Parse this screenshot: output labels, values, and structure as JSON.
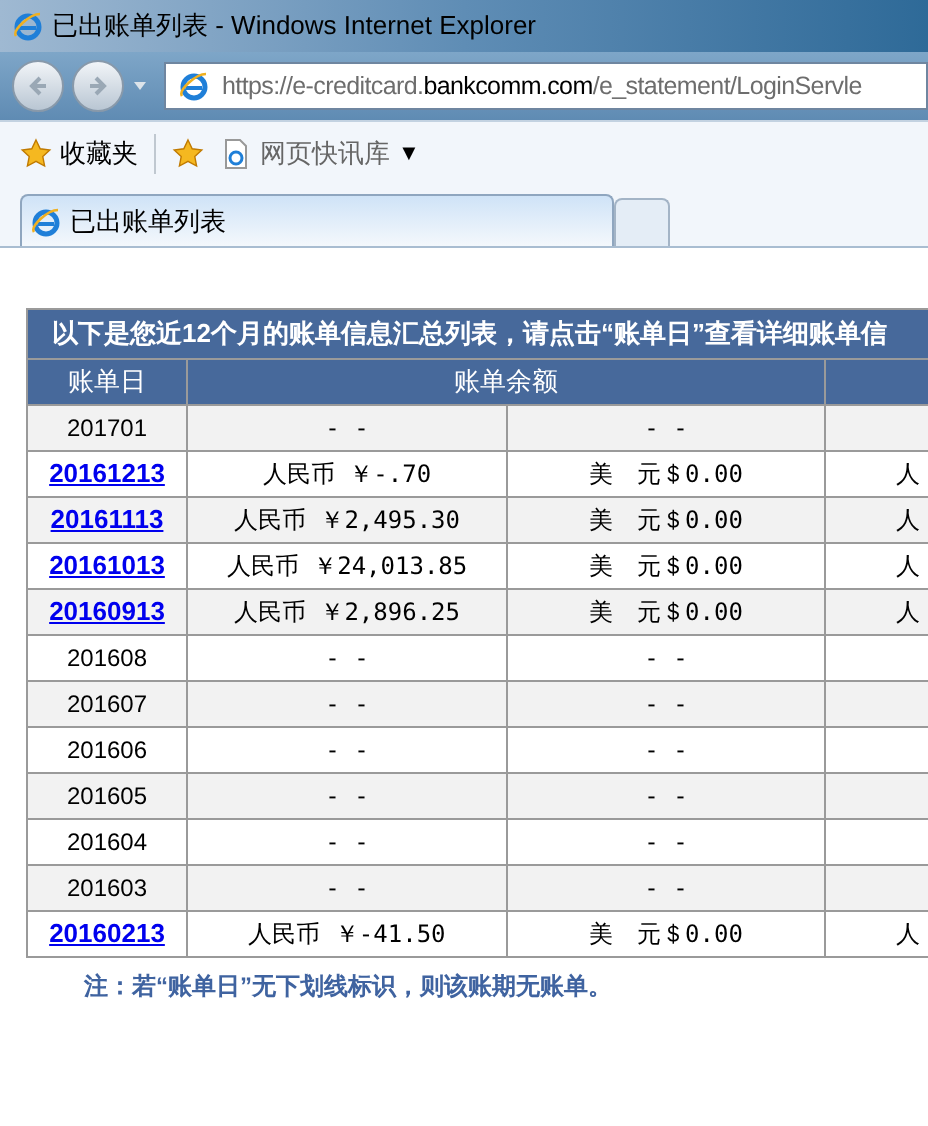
{
  "window": {
    "title": "已出账单列表 - Windows Internet Explorer"
  },
  "address_bar": {
    "url_prefix": "https://e-creditcard.",
    "url_domain": "bankcomm.com",
    "url_path": "/e_statement/LoginServle"
  },
  "favorites_bar": {
    "favorites_label": "收藏夹",
    "feed_label": "网页快讯库",
    "feed_menu_glyph": "▼"
  },
  "tabs": [
    {
      "label": "已出账单列表",
      "selected": true
    },
    {
      "selected": false
    }
  ],
  "table": {
    "caption": "以下是您近12个月的账单信息汇总列表，请点击“账单日”查看详细账单信",
    "columns": [
      "账单日",
      "账单余额"
    ],
    "rows": [
      {
        "date": "201701",
        "linked": false,
        "cny": "- -",
        "usd": "- -"
      },
      {
        "date": "20161213",
        "linked": true,
        "cny": "人民币 ￥-.70",
        "usd": "美　元＄0.00",
        "column_4": "人"
      },
      {
        "date": "20161113",
        "linked": true,
        "cny": "人民币 ￥2,495.30",
        "usd": "美　元＄0.00",
        "column_4": "人"
      },
      {
        "date": "20161013",
        "linked": true,
        "cny": "人民币 ￥24,013.85",
        "usd": "美　元＄0.00",
        "column_4": "人"
      },
      {
        "date": "20160913",
        "linked": true,
        "cny": "人民币 ￥2,896.25",
        "usd": "美　元＄0.00",
        "column_4": "人"
      },
      {
        "date": "201608",
        "linked": false,
        "cny": "- -",
        "usd": "- -"
      },
      {
        "date": "201607",
        "linked": false,
        "cny": "- -",
        "usd": "- -"
      },
      {
        "date": "201606",
        "linked": false,
        "cny": "- -",
        "usd": "- -"
      },
      {
        "date": "201605",
        "linked": false,
        "cny": "- -",
        "usd": "- -"
      },
      {
        "date": "201604",
        "linked": false,
        "cny": "- -",
        "usd": "- -"
      },
      {
        "date": "201603",
        "linked": false,
        "cny": "- -",
        "usd": "- -"
      },
      {
        "date": "20160213",
        "linked": true,
        "cny": "人民币 ￥-41.50",
        "usd": "美　元＄0.00",
        "column_4": "人"
      }
    ]
  },
  "note": "注：若“账单日”无下划线标识，则该账期无账单。"
}
